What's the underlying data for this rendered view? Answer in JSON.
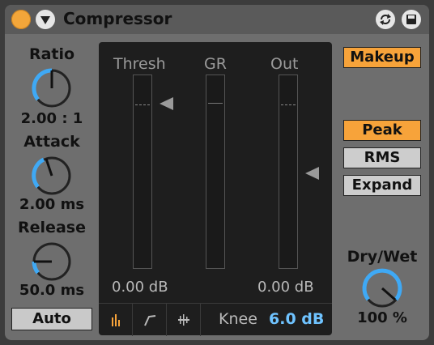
{
  "device": {
    "title": "Compressor"
  },
  "ratio": {
    "label": "Ratio",
    "value": "2.00 : 1"
  },
  "attack": {
    "label": "Attack",
    "value": "2.00 ms"
  },
  "release": {
    "label": "Release",
    "value": "50.0 ms"
  },
  "auto_label": "Auto",
  "meters": {
    "thresh_label": "Thresh",
    "gr_label": "GR",
    "out_label": "Out",
    "thresh_value": "0.00 dB",
    "out_value": "0.00 dB"
  },
  "knee": {
    "label": "Knee",
    "value": "6.0 dB"
  },
  "makeup_label": "Makeup",
  "modes": {
    "peak": "Peak",
    "rms": "RMS",
    "expand": "Expand",
    "selected": "Peak"
  },
  "drywet": {
    "label": "Dry/Wet",
    "value": "100 %"
  },
  "colors": {
    "accent_orange": "#f7a33a",
    "accent_blue": "#3fa9f5",
    "knee_value_blue": "#6fc3ff",
    "panel_bg": "#6e6e6e",
    "meter_bg": "#1e1e1e"
  }
}
